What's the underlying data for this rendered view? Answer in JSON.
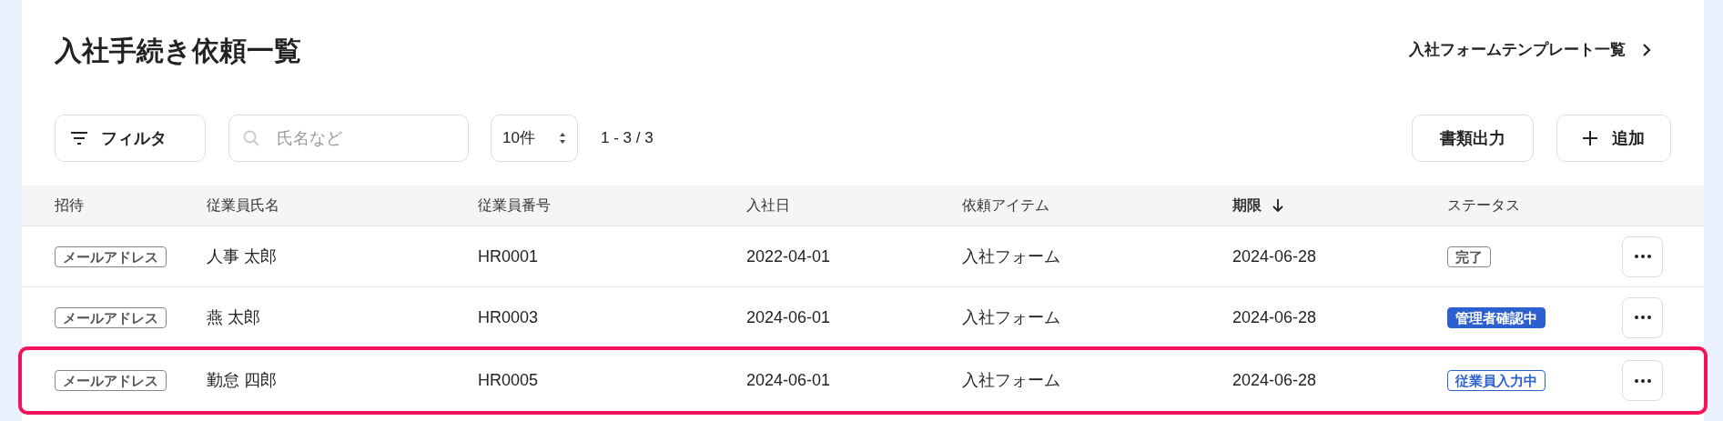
{
  "page": {
    "title": "入社手続き依頼一覧",
    "template_link": "入社フォームテンプレート一覧"
  },
  "toolbar": {
    "filter_button": "フィルタ",
    "search": {
      "placeholder": "氏名など"
    },
    "page_size": "10件",
    "range": "1 - 3 / 3",
    "export_button": "書類出力",
    "add_button": "追加"
  },
  "table": {
    "columns": [
      {
        "label": "招待",
        "sorted": false
      },
      {
        "label": "従業員氏名",
        "sorted": false
      },
      {
        "label": "従業員番号",
        "sorted": false
      },
      {
        "label": "入社日",
        "sorted": false
      },
      {
        "label": "依頼アイテム",
        "sorted": false
      },
      {
        "label": "期限",
        "sorted": true
      },
      {
        "label": "ステータス",
        "sorted": false
      }
    ],
    "rows": [
      {
        "invite": "メールアドレス",
        "name": "人事 太郎",
        "number": "HR0001",
        "join_date": "2022-04-01",
        "item": "入社フォーム",
        "due": "2024-06-28",
        "status": {
          "label": "完了",
          "kind": "done"
        },
        "highlighted": false
      },
      {
        "invite": "メールアドレス",
        "name": "燕 太郎",
        "number": "HR0003",
        "join_date": "2024-06-01",
        "item": "入社フォーム",
        "due": "2024-06-28",
        "status": {
          "label": "管理者確認中",
          "kind": "review"
        },
        "highlighted": false
      },
      {
        "invite": "メールアドレス",
        "name": "勤怠 四郎",
        "number": "HR0005",
        "join_date": "2024-06-01",
        "item": "入社フォーム",
        "due": "2024-06-28",
        "status": {
          "label": "従業員入力中",
          "kind": "input"
        },
        "highlighted": true
      }
    ]
  }
}
